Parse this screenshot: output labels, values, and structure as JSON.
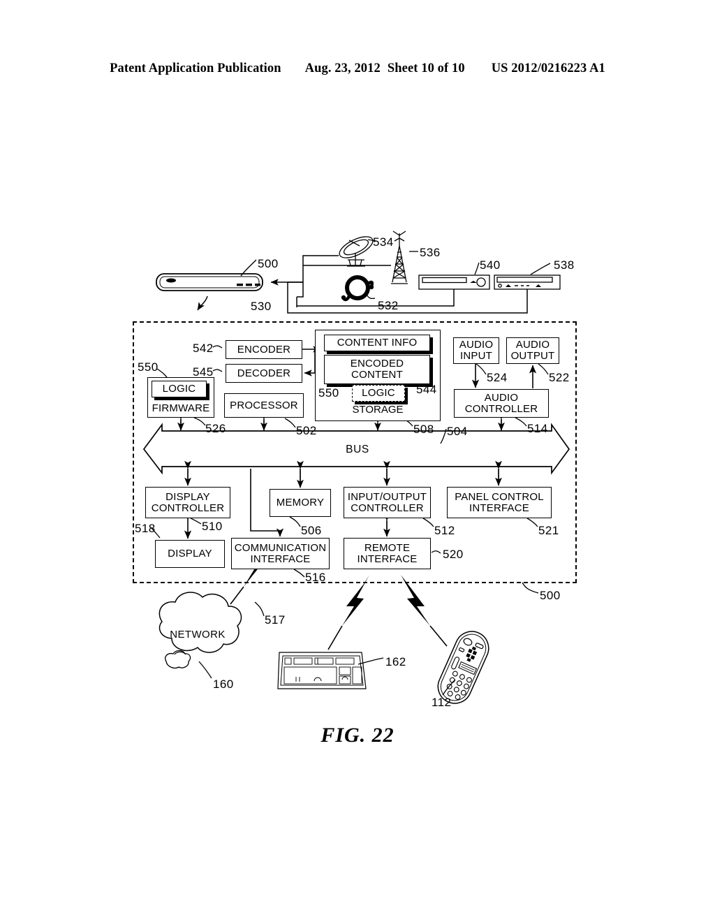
{
  "header": {
    "publication": "Patent Application Publication",
    "date": "Aug. 23, 2012",
    "sheet": "Sheet 10 of 10",
    "doc_number": "US 2012/0216223 A1"
  },
  "figure": {
    "caption": "FIG. 22",
    "system_label": "500"
  },
  "blocks": {
    "encoder": "ENCODER",
    "decoder": "DECODER",
    "content_info": "CONTENT INFO",
    "encoded_content_l1": "ENCODED",
    "encoded_content_l2": "CONTENT",
    "storage_logic": "LOGIC",
    "storage": "STORAGE",
    "firmware_logic": "LOGIC",
    "firmware": "FIRMWARE",
    "processor": "PROCESSOR",
    "audio_input_l1": "AUDIO",
    "audio_input_l2": "INPUT",
    "audio_output_l1": "AUDIO",
    "audio_output_l2": "OUTPUT",
    "audio_controller_l1": "AUDIO",
    "audio_controller_l2": "CONTROLLER",
    "bus": "BUS",
    "display_controller_l1": "DISPLAY",
    "display_controller_l2": "CONTROLLER",
    "memory": "MEMORY",
    "io_controller_l1": "INPUT/OUTPUT",
    "io_controller_l2": "CONTROLLER",
    "panel_control_l1": "PANEL CONTROL",
    "panel_control_l2": "INTERFACE",
    "display": "DISPLAY",
    "communication_l1": "COMMUNICATION",
    "communication_l2": "INTERFACE",
    "remote_l1": "REMOTE",
    "remote_l2": "INTERFACE",
    "network": "NETWORK"
  },
  "refs": {
    "r500_top": "500",
    "r500_bottom": "500",
    "r502": "502",
    "r504": "504",
    "r506": "506",
    "r508": "508",
    "r510": "510",
    "r512": "512",
    "r514": "514",
    "r516": "516",
    "r517": "517",
    "r518": "518",
    "r520": "520",
    "r521": "521",
    "r522": "522",
    "r524": "524",
    "r526": "526",
    "r530": "530",
    "r532": "532",
    "r534": "534",
    "r536": "536",
    "r538": "538",
    "r540": "540",
    "r542": "542",
    "r544": "544",
    "r545": "545",
    "r550_firmware": "550",
    "r550_storage": "550",
    "r160": "160",
    "r162": "162",
    "r112": "112"
  },
  "devices": {
    "set_top_box": "set-top-box",
    "satellite_dish": "satellite-dish",
    "antenna_tower": "antenna-tower",
    "cable_coil": "cable-coil",
    "media_player_540": "media-player",
    "media_player_538": "media-player",
    "keyboard": "keyboard",
    "remote_control": "remote-control",
    "network_cloud": "network-cloud"
  },
  "colors": {
    "ink": "#000000",
    "paper": "#ffffff"
  }
}
